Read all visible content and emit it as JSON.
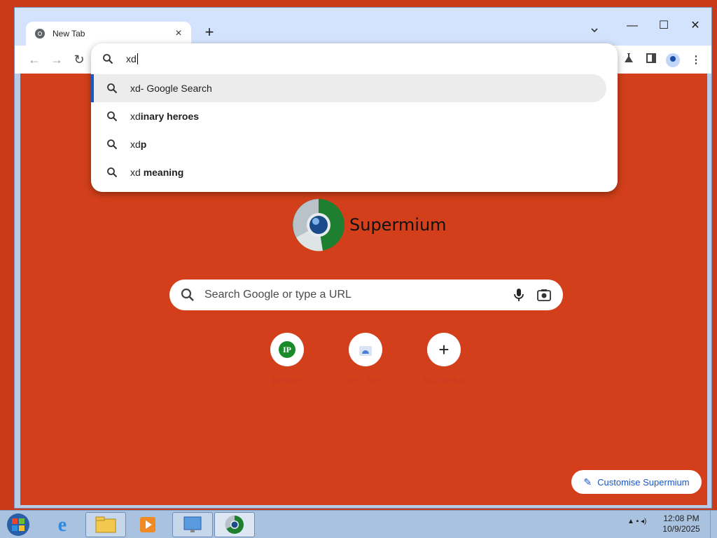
{
  "browser": {
    "tab_title": "New Tab",
    "tab_close": "×",
    "new_tab": "+",
    "window_controls": {
      "minimize": "—",
      "maximize": "☐",
      "close": "✕"
    }
  },
  "toolbar": {
    "back": "←",
    "forward": "→",
    "reload": "↻",
    "menu": "⋮"
  },
  "omnibox": {
    "input_value": "xd",
    "suggestions": [
      {
        "prefix": "xd",
        "rest": " - Google Search",
        "bold": false
      },
      {
        "prefix": "xd",
        "rest": "inary heroes",
        "bold": true
      },
      {
        "prefix": "xd",
        "rest": "p",
        "bold": true
      },
      {
        "prefix": "xd ",
        "rest": "meaning",
        "bold": true
      }
    ]
  },
  "ntp": {
    "brand": "Supermium",
    "search_placeholder": "Search Google or type a URL",
    "shortcuts": [
      {
        "label": "ipchicken",
        "badge": "IP"
      },
      {
        "label": "Web Store",
        "badge": ""
      },
      {
        "label": "Add shortcut",
        "badge": "+"
      }
    ],
    "customise_label": "Customise Supermium"
  },
  "taskbar": {
    "time": "12:08 PM",
    "date": "10/9/2025"
  },
  "colors": {
    "page_bg": "#d23f1a",
    "accent": "#1a56c4",
    "titlebar": "#d3e3fd"
  }
}
